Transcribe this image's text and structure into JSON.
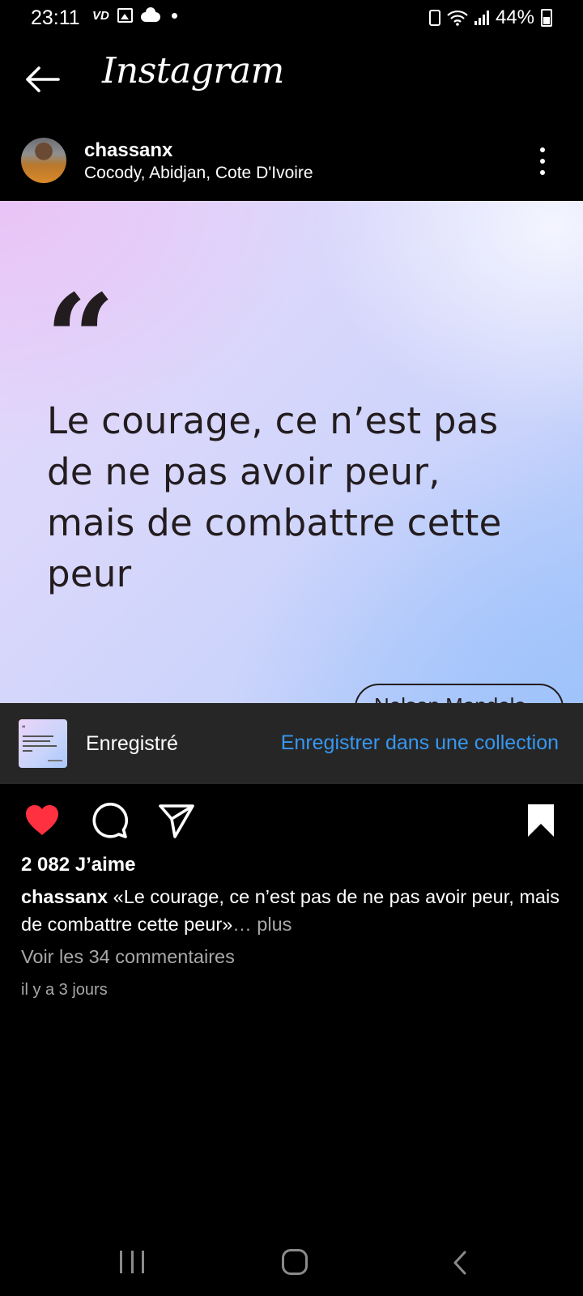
{
  "status_bar": {
    "time": "23:11",
    "carrier_badge": "VD",
    "battery_percent": "44%",
    "icons": [
      "vd-icon",
      "gallery-icon",
      "cloud-icon",
      "notification-dot-icon",
      "battery-saver-icon",
      "wifi-icon",
      "signal-icon",
      "battery-icon"
    ]
  },
  "header": {
    "logo": "Instagram",
    "back_icon": "arrow-left-icon"
  },
  "post": {
    "username": "chassanx",
    "location": "Cocody, Abidjan, Cote D'Ivoire",
    "more_icon": "more-vertical-icon",
    "image": {
      "quote_mark": "“",
      "quote_lines": [
        "Le courage, ce n’est pas",
        "de ne pas avoir peur,",
        "mais de combattre cette",
        "peur"
      ],
      "author": "Nelson Mandela"
    }
  },
  "saved_toast": {
    "label": "Enregistré",
    "action": "Enregistrer dans une collection"
  },
  "actions": {
    "like_icon": "heart-filled-icon",
    "comment_icon": "comment-icon",
    "share_icon": "send-icon",
    "save_icon": "bookmark-filled-icon",
    "liked": true,
    "saved": true
  },
  "likes_text": "2 082 J’aime",
  "caption": {
    "username": "chassanx",
    "text": "«Le courage, ce n’est pas de ne pas avoir peur, mais de combattre cette peur»",
    "more": "… plus"
  },
  "comments_link": "Voir les 34 commentaires",
  "timestamp": "il y a 3 jours",
  "nav_bar": {
    "icons": [
      "recent-apps-icon",
      "home-icon",
      "back-icon"
    ]
  },
  "colors": {
    "background": "#000000",
    "like_red": "#ff3040",
    "link_blue": "#3797f0",
    "secondary_text": "#a8a8a8",
    "toast_bg": "#262626"
  }
}
